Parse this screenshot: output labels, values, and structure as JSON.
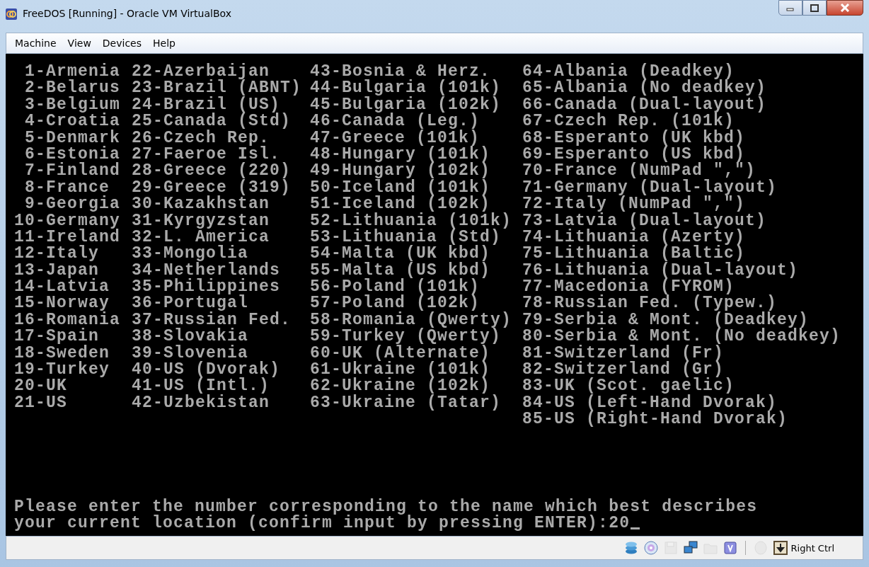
{
  "window": {
    "title": "FreeDOS [Running] - Oracle VM VirtualBox"
  },
  "menu": [
    "Machine",
    "View",
    "Devices",
    "Help"
  ],
  "console": {
    "columns": [
      [
        " 1-Armenia",
        " 2-Belarus",
        " 3-Belgium",
        " 4-Croatia",
        " 5-Denmark",
        " 6-Estonia",
        " 7-Finland",
        " 8-France",
        " 9-Georgia",
        "10-Germany",
        "11-Ireland",
        "12-Italy",
        "13-Japan",
        "14-Latvia",
        "15-Norway",
        "16-Romania",
        "17-Spain",
        "18-Sweden",
        "19-Turkey",
        "20-UK",
        "21-US"
      ],
      [
        "22-Azerbaijan",
        "23-Brazil (ABNT)",
        "24-Brazil (US)",
        "25-Canada (Std)",
        "26-Czech Rep.",
        "27-Faeroe Isl.",
        "28-Greece (220)",
        "29-Greece (319)",
        "30-Kazakhstan",
        "31-Kyrgyzstan",
        "32-L. America",
        "33-Mongolia",
        "34-Netherlands",
        "35-Philippines",
        "36-Portugal",
        "37-Russian Fed.",
        "38-Slovakia",
        "39-Slovenia",
        "40-US (Dvorak)",
        "41-US (Intl.)",
        "42-Uzbekistan"
      ],
      [
        "43-Bosnia & Herz.",
        "44-Bulgaria (101k)",
        "45-Bulgaria (102k)",
        "46-Canada (Leg.)",
        "47-Greece (101k)",
        "48-Hungary (101k)",
        "49-Hungary (102k)",
        "50-Iceland (101k)",
        "51-Iceland (102k)",
        "52-Lithuania (101k)",
        "53-Lithuania (Std)",
        "54-Malta (UK kbd)",
        "55-Malta (US kbd)",
        "56-Poland (101k)",
        "57-Poland (102k)",
        "58-Romania (Qwerty)",
        "59-Turkey (Qwerty)",
        "60-UK (Alternate)",
        "61-Ukraine (101k)",
        "62-Ukraine (102k)",
        "63-Ukraine (Tatar)"
      ],
      [
        "64-Albania (Deadkey)",
        "65-Albania (No deadkey)",
        "66-Canada (Dual-layout)",
        "67-Czech Rep. (101k)",
        "68-Esperanto (UK kbd)",
        "69-Esperanto (US kbd)",
        "70-France (NumPad \",\")",
        "71-Germany (Dual-layout)",
        "72-Italy (NumPad \",\")",
        "73-Latvia (Dual-layout)",
        "74-Lithuania (Azerty)",
        "75-Lithuania (Baltic)",
        "76-Lithuania (Dual-layout)",
        "77-Macedonia (FYROM)",
        "78-Russian Fed. (Typew.)",
        "79-Serbia & Mont. (Deadkey)",
        "80-Serbia & Mont. (No deadkey)",
        "81-Switzerland (Fr)",
        "82-Switzerland (Gr)",
        "83-UK (Scot. gaelic)",
        "84-US (Left-Hand Dvorak)",
        "85-US (Right-Hand Dvorak)"
      ]
    ],
    "prompt": [
      "Please enter the number corresponding to the name which best describes",
      "your current location (confirm input by pressing ENTER):"
    ],
    "input": "20"
  },
  "status_bar": {
    "indicators": [
      {
        "kind": "hard-disk",
        "disabled": false
      },
      {
        "kind": "optical-disc",
        "disabled": false
      },
      {
        "kind": "floppy",
        "disabled": true
      },
      {
        "kind": "network",
        "disabled": false
      },
      {
        "kind": "shared-folder",
        "disabled": true
      },
      {
        "kind": "chip",
        "disabled": false
      },
      {
        "kind": "mouse",
        "disabled": true
      },
      {
        "kind": "host-key",
        "disabled": false
      }
    ],
    "host_key": "Right Ctrl"
  }
}
